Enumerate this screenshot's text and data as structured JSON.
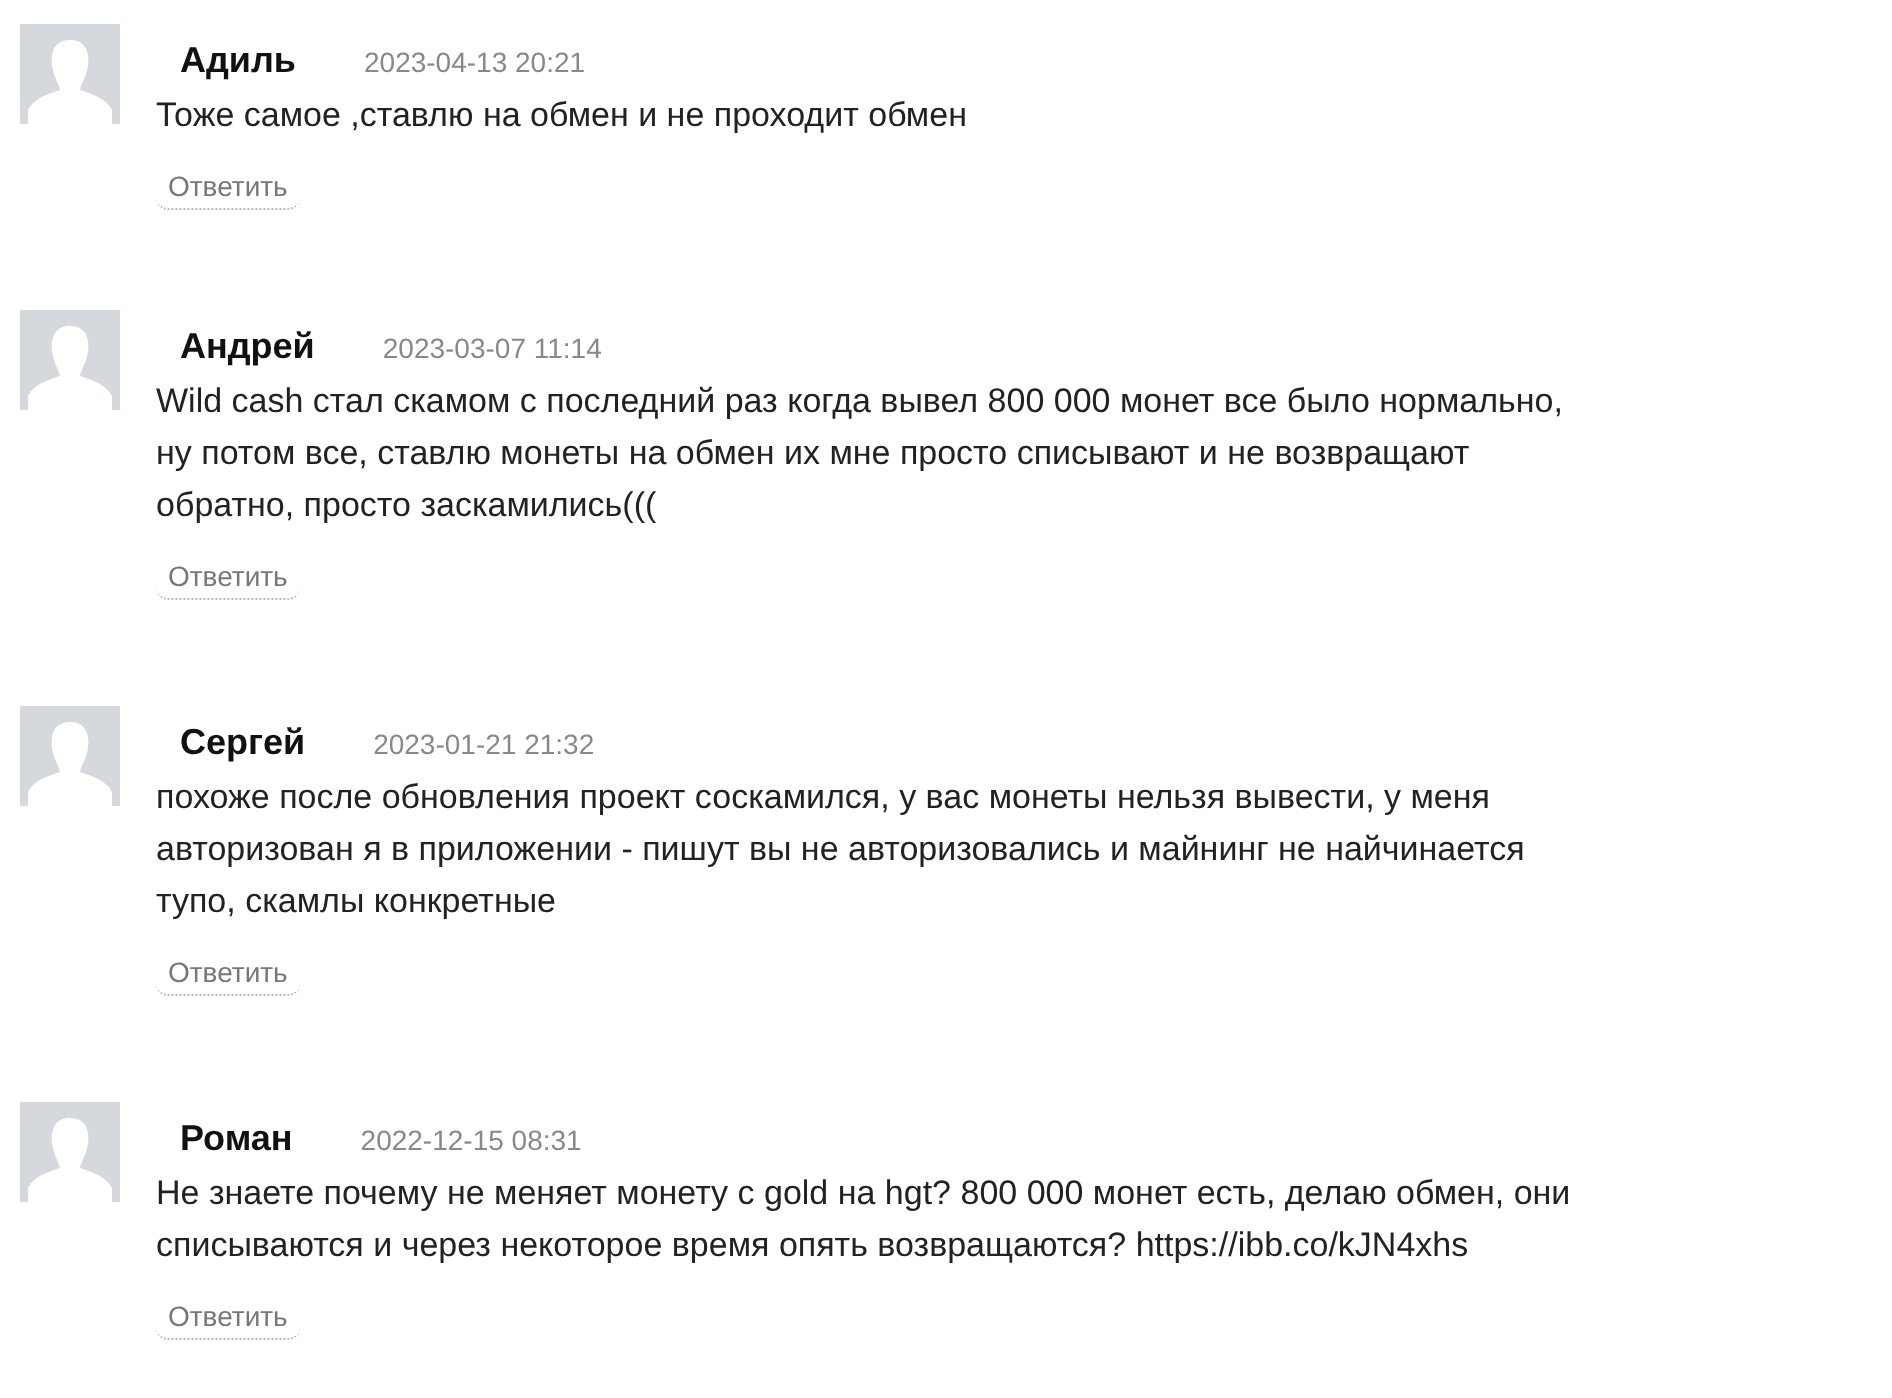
{
  "comments": [
    {
      "author": "Адиль",
      "date": "2023-04-13 20:21",
      "lines": [
        "Тоже самое ,ставлю на обмен и не проходит обмен"
      ],
      "reply": "Ответить"
    },
    {
      "author": "Андрей",
      "date": "2023-03-07 11:14",
      "lines": [
        "Wild cash стал скамом с последний раз когда вывел 800 000 монет все было нормально,",
        "ну потом все, ставлю монеты на обмен их мне просто списывают и не возвращают",
        "обратно, просто заскамились((("
      ],
      "reply": "Ответить"
    },
    {
      "author": "Сергей",
      "date": "2023-01-21 21:32",
      "lines": [
        "похоже после обновления проект соскамился, у вас монеты нельзя вывести, у меня",
        "авторизован я в приложении - пишут вы не авторизовались и майнинг не найчинается",
        "тупо, скамлы конкретные"
      ],
      "reply": "Ответить"
    },
    {
      "author": "Роман",
      "date": "2022-12-15 08:31",
      "lines": [
        "Не знаете почему не меняет монету с gold на hgt? 800 000 монет есть, делаю обмен, они",
        "списываются и через некоторое время опять возвращаются? https://ibb.co/kJN4xhs"
      ],
      "reply": "Ответить"
    }
  ]
}
